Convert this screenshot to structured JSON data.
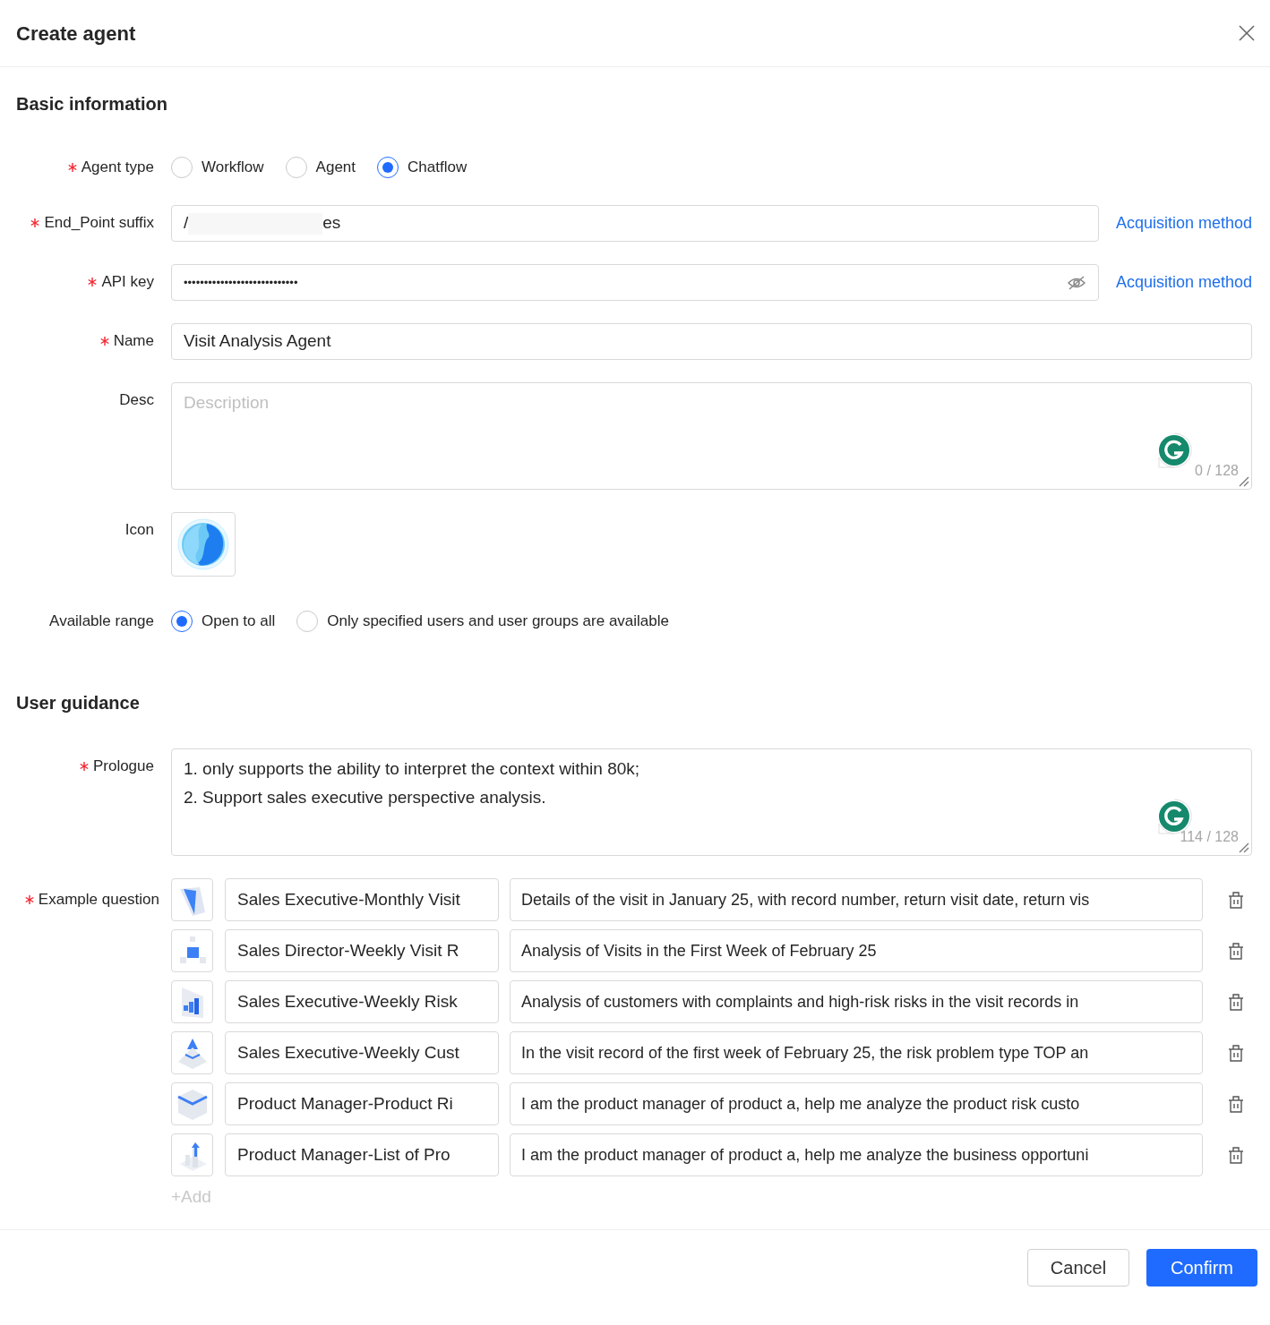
{
  "dialog": {
    "title": "Create agent"
  },
  "basic_information": {
    "title": "Basic information",
    "agent_type": {
      "label": "Agent type",
      "required": true,
      "options": [
        {
          "label": "Workflow",
          "selected": false
        },
        {
          "label": "Agent",
          "selected": false
        },
        {
          "label": "Chatflow",
          "selected": true
        }
      ]
    },
    "endpoint": {
      "label": "End_Point suffix",
      "required": true,
      "value_start": "/",
      "value_end": "es",
      "link": "Acquisition method"
    },
    "api_key": {
      "label": "API key",
      "required": true,
      "value": "••••••••••••••••••••••••••••",
      "link": "Acquisition method"
    },
    "name": {
      "label": "Name",
      "required": true,
      "value": "Visit Analysis Agent"
    },
    "desc": {
      "label": "Desc",
      "required": false,
      "placeholder": "Description",
      "counter": "0 / 128"
    },
    "icon": {
      "label": "Icon",
      "required": false
    },
    "available_range": {
      "label": "Available range",
      "required": false,
      "options": [
        {
          "label": "Open to all",
          "selected": true
        },
        {
          "label": "Only specified users and user groups are available",
          "selected": false
        }
      ]
    }
  },
  "user_guidance": {
    "title": "User guidance",
    "prologue": {
      "label": "Prologue",
      "required": true,
      "lines": [
        "1. only supports the ability to interpret the context within 80k;",
        "2. Support sales executive perspective analysis."
      ],
      "counter": "114 / 128"
    },
    "example_question": {
      "label": "Example question",
      "required": true,
      "items": [
        {
          "kind": "panel",
          "name": "Sales Executive-Monthly Visit",
          "question": "Details of the visit in January 25, with record number, return visit date, return vis"
        },
        {
          "kind": "cubes",
          "name": "Sales Director-Weekly Visit R",
          "question": "Analysis of Visits in the First Week of February 25"
        },
        {
          "kind": "bars",
          "name": "Sales Executive-Weekly Risk",
          "question": "Analysis of customers with complaints and high-risk risks in the visit records in"
        },
        {
          "kind": "pyramid",
          "name": "Sales Executive-Weekly Cust",
          "question": "In the visit record of the first week of February 25, the risk problem type TOP an"
        },
        {
          "kind": "box",
          "name": "Product Manager-Product Ri",
          "question": "I am the product manager of product a, help me analyze the product risk custo"
        },
        {
          "kind": "growth",
          "name": "Product Manager-List of Pro",
          "question": "I am the product manager of product a, help me analyze the business opportuni"
        }
      ],
      "add": "+Add"
    }
  },
  "buttons": {
    "cancel": "Cancel",
    "confirm": "Confirm"
  }
}
